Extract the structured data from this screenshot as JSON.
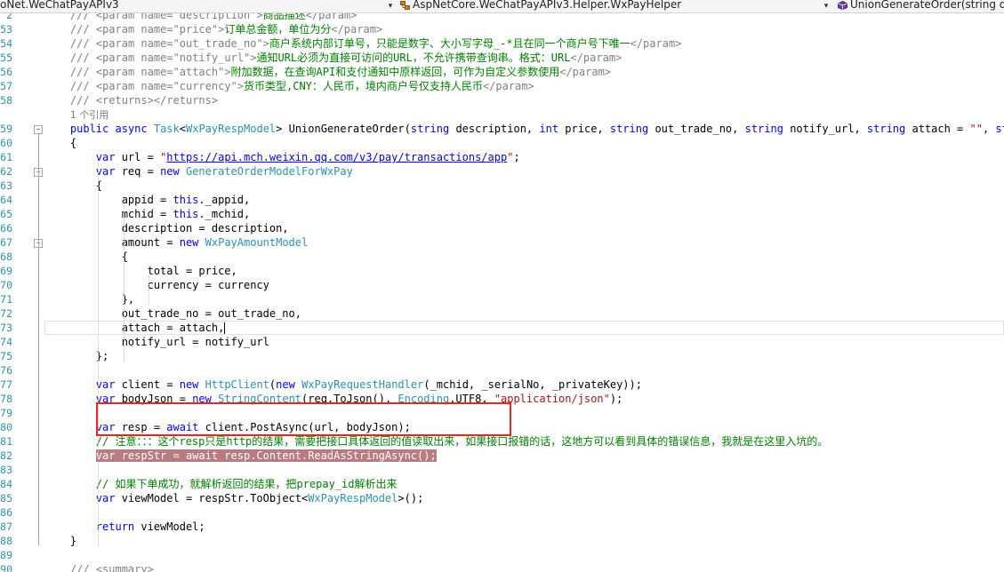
{
  "navbar": {
    "project": "oNet.WeChatPayAPIv3",
    "class_name": "AspNetCore.WeChatPayAPIv3.Helper.WxPayHelper",
    "member_name": "UnionGenerateOrder(string de"
  },
  "editor": {
    "lines": [
      {
        "n": "2",
        "html": "    <span class=\"x\">///</span><span class=\"c\"> </span><span class=\"x\">&lt;param name=\"description\"&gt;</span><span class=\"c\">商品描述</span><span class=\"x\">&lt;/param&gt;</span>"
      },
      {
        "n": "53",
        "html": "    <span class=\"x\">///</span><span class=\"c\"> </span><span class=\"x\">&lt;param name=\"price\"&gt;</span><span class=\"c\">订单总金额，单位为分</span><span class=\"x\">&lt;/param&gt;</span>"
      },
      {
        "n": "54",
        "html": "    <span class=\"x\">///</span><span class=\"c\"> </span><span class=\"x\">&lt;param name=\"out_trade_no\"&gt;</span><span class=\"c\">商户系统内部订单号，只能是数字、大小写字母_-*且在同一个商户号下唯一</span><span class=\"x\">&lt;/param&gt;</span>"
      },
      {
        "n": "55",
        "html": "    <span class=\"x\">///</span><span class=\"c\"> </span><span class=\"x\">&lt;param name=\"notify_url\"&gt;</span><span class=\"c\">通知URL必须为直接可访问的URL，不允许携带查询串。格式：URL</span><span class=\"x\">&lt;/param&gt;</span>"
      },
      {
        "n": "56",
        "html": "    <span class=\"x\">///</span><span class=\"c\"> </span><span class=\"x\">&lt;param name=\"attach\"&gt;</span><span class=\"c\">附加数据，在查询API和支付通知中原样返回，可作为自定义参数使用</span><span class=\"x\">&lt;/param&gt;</span>"
      },
      {
        "n": "57",
        "html": "    <span class=\"x\">///</span><span class=\"c\"> </span><span class=\"x\">&lt;param name=\"currency\"&gt;</span><span class=\"c\">货币类型,CNY：人民币，境内商户号仅支持人民币</span><span class=\"x\">&lt;/param&gt;</span>"
      },
      {
        "n": "58",
        "html": "    <span class=\"x\">///</span><span class=\"c\"> </span><span class=\"x\">&lt;returns&gt;&lt;/returns&gt;</span>"
      },
      {
        "n": "",
        "html": "    <span class=\"ref\">1 个引用</span>"
      },
      {
        "n": "59",
        "html": "    <span class=\"k\">public</span> <span class=\"k\">async</span> <span class=\"t\">Task</span>&lt;<span class=\"t\">WxPayRespModel</span>&gt; UnionGenerateOrder(<span class=\"k\">string</span> description, <span class=\"k\">int</span> price, <span class=\"k\">string</span> out_trade_no, <span class=\"k\">string</span> notify_url, <span class=\"k\">string</span> attach = <span class=\"s\">\"\"</span>, <span class=\"k\">st</span>"
      },
      {
        "n": "60",
        "html": "    {"
      },
      {
        "n": "61",
        "html": "        <span class=\"k\">var</span> url = <span class=\"s\">\"<span class=\"url\">https://api.mch.weixin.qq.com/v3/pay/transactions/app</span>\"</span>;"
      },
      {
        "n": "62",
        "html": "        <span class=\"k\">var</span> req = <span class=\"k\">new</span> <span class=\"t\">GenerateOrderModelForWxPay</span>"
      },
      {
        "n": "63",
        "html": "        {"
      },
      {
        "n": "64",
        "html": "            appid = <span class=\"k\">this</span>._appid,"
      },
      {
        "n": "65",
        "html": "            mchid = <span class=\"k\">this</span>._mchid,"
      },
      {
        "n": "66",
        "html": "            description = description,"
      },
      {
        "n": "67",
        "html": "            amount = <span class=\"k\">new</span> <span class=\"t\">WxPayAmountModel</span>"
      },
      {
        "n": "68",
        "html": "            {"
      },
      {
        "n": "69",
        "html": "                total = price,"
      },
      {
        "n": "70",
        "html": "                currency = currency"
      },
      {
        "n": "71",
        "html": "            },"
      },
      {
        "n": "72",
        "html": "            out_trade_no = out_trade_no,"
      },
      {
        "n": "73",
        "html": "            attach = attach,<span class=\"caret\"></span>"
      },
      {
        "n": "74",
        "html": "            notify_url = notify_url"
      },
      {
        "n": "75",
        "html": "        };"
      },
      {
        "n": "76",
        "html": ""
      },
      {
        "n": "77",
        "html": "        <span class=\"k\">var</span> client = <span class=\"k\">new</span> <span class=\"t\">HttpClient</span>(<span class=\"k\">new</span> <span class=\"t\">WxPayRequestHandler</span>(_mchid, _serialNo, _privateKey));"
      },
      {
        "n": "78",
        "html": "        <span class=\"k\">var</span> bodyJson = <span class=\"k\">new</span> <span class=\"t\">StringContent</span>(req.ToJson(), <span class=\"t\">Encoding</span>.UTF8, <span class=\"s\">\"application/json\"</span>);"
      },
      {
        "n": "79",
        "html": ""
      },
      {
        "n": "80",
        "html": "        <span class=\"k\">var</span> resp = <span class=\"k\">await</span> client.PostAsync(url, bodyJson);"
      },
      {
        "n": "81",
        "html": "        <span class=\"c\">// 注意：：：这个resp只是http的结果，需要把接口具体返回的值读取出来，如果接口报错的话，这地方可以看到具体的错误信息，我就是在这里入坑的。</span>"
      },
      {
        "n": "82",
        "html": "        <span class=\"hl\">var respStr = await resp.Content.ReadAsStringAsync();</span>"
      },
      {
        "n": "83",
        "html": ""
      },
      {
        "n": "84",
        "html": "        <span class=\"c\">// 如果下单成功，就解析返回的结果，把prepay_id解析出来</span>"
      },
      {
        "n": "85",
        "html": "        <span class=\"k\">var</span> viewModel = respStr.ToObject&lt;<span class=\"t\">WxPayRespModel</span>&gt;();"
      },
      {
        "n": "86",
        "html": ""
      },
      {
        "n": "87",
        "html": "        <span class=\"k\">return</span> viewModel;"
      },
      {
        "n": "88",
        "html": "    }"
      },
      {
        "n": "89",
        "html": ""
      },
      {
        "n": "90",
        "html": "    <span class=\"x\">/// &lt;summary&gt;</span>"
      }
    ]
  },
  "colors": {
    "highlight_box": "#e8251e",
    "line_number": "#2b91af",
    "keyword": "#0000ff",
    "type": "#2b91af",
    "comment": "#008000",
    "selection": "#b97a80"
  }
}
